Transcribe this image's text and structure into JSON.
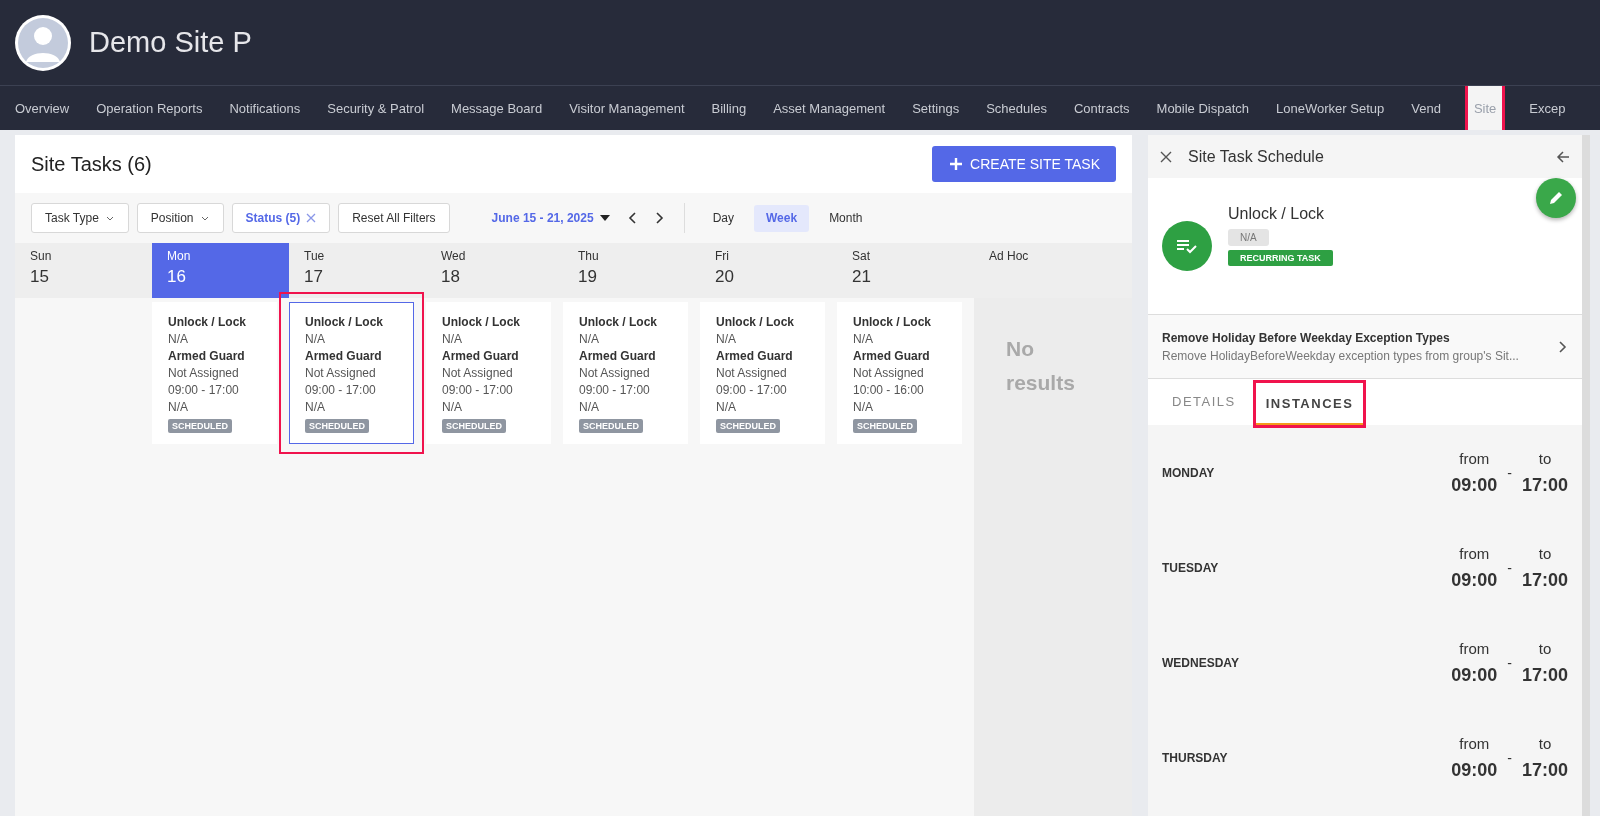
{
  "site": {
    "name": "Demo Site P"
  },
  "nav": [
    {
      "label": "Overview",
      "selected": false,
      "highlighted": false
    },
    {
      "label": "Operation Reports",
      "selected": false,
      "highlighted": false
    },
    {
      "label": "Notifications",
      "selected": false,
      "highlighted": false
    },
    {
      "label": "Security & Patrol",
      "selected": false,
      "highlighted": false
    },
    {
      "label": "Message Board",
      "selected": false,
      "highlighted": false
    },
    {
      "label": "Visitor Management",
      "selected": false,
      "highlighted": false
    },
    {
      "label": "Billing",
      "selected": false,
      "highlighted": false
    },
    {
      "label": "Asset Management",
      "selected": false,
      "highlighted": false
    },
    {
      "label": "Settings",
      "selected": false,
      "highlighted": false
    },
    {
      "label": "Schedules",
      "selected": false,
      "highlighted": false
    },
    {
      "label": "Contracts",
      "selected": false,
      "highlighted": false
    },
    {
      "label": "Mobile Dispatch",
      "selected": false,
      "highlighted": false
    },
    {
      "label": "LoneWorker Setup",
      "selected": false,
      "highlighted": false
    },
    {
      "label": "Vend",
      "selected": false,
      "highlighted": false
    },
    {
      "label": "Site",
      "selected": true,
      "highlighted": true
    },
    {
      "label": "Excep",
      "selected": false,
      "highlighted": false
    }
  ],
  "tasks": {
    "title": "Site Tasks (6)",
    "create_button": "CREATE SITE TASK",
    "filters": [
      {
        "label": "Task Type",
        "kind": "dropdown",
        "active": false
      },
      {
        "label": "Position",
        "kind": "dropdown",
        "active": false
      },
      {
        "label": "Status (5)",
        "kind": "clearable",
        "active": true
      },
      {
        "label": "Reset All Filters",
        "kind": "button",
        "active": false
      }
    ],
    "date_range": "June 15 - 21, 2025",
    "views": [
      {
        "label": "Day",
        "selected": false
      },
      {
        "label": "Week",
        "selected": true
      },
      {
        "label": "Month",
        "selected": false
      }
    ],
    "days": [
      {
        "weekday": "Sun",
        "date": "15",
        "selected": false
      },
      {
        "weekday": "Mon",
        "date": "16",
        "selected": true,
        "events": [
          {
            "title": "Unlock / Lock",
            "line_1": "N/A",
            "position": "Armed Guard",
            "assignee": "Not Assigned",
            "time": "09:00 - 17:00",
            "line_2": "N/A",
            "status": "SCHEDULED",
            "selected": false,
            "highlighted": false
          }
        ]
      },
      {
        "weekday": "Tue",
        "date": "17",
        "selected": false,
        "events": [
          {
            "title": "Unlock / Lock",
            "line_1": "N/A",
            "position": "Armed Guard",
            "assignee": "Not Assigned",
            "time": "09:00 - 17:00",
            "line_2": "N/A",
            "status": "SCHEDULED",
            "selected": true,
            "highlighted": true
          }
        ]
      },
      {
        "weekday": "Wed",
        "date": "18",
        "selected": false,
        "events": [
          {
            "title": "Unlock / Lock",
            "line_1": "N/A",
            "position": "Armed Guard",
            "assignee": "Not Assigned",
            "time": "09:00 - 17:00",
            "line_2": "N/A",
            "status": "SCHEDULED",
            "selected": false,
            "highlighted": false
          }
        ]
      },
      {
        "weekday": "Thu",
        "date": "19",
        "selected": false,
        "events": [
          {
            "title": "Unlock / Lock",
            "line_1": "N/A",
            "position": "Armed Guard",
            "assignee": "Not Assigned",
            "time": "09:00 - 17:00",
            "line_2": "N/A",
            "status": "SCHEDULED",
            "selected": false,
            "highlighted": false
          }
        ]
      },
      {
        "weekday": "Fri",
        "date": "20",
        "selected": false,
        "events": [
          {
            "title": "Unlock / Lock",
            "line_1": "N/A",
            "position": "Armed Guard",
            "assignee": "Not Assigned",
            "time": "09:00 - 17:00",
            "line_2": "N/A",
            "status": "SCHEDULED",
            "selected": false,
            "highlighted": false
          }
        ]
      },
      {
        "weekday": "Sat",
        "date": "21",
        "selected": false,
        "events": [
          {
            "title": "Unlock / Lock",
            "line_1": "N/A",
            "position": "Armed Guard",
            "assignee": "Not Assigned",
            "time": "10:00 - 16:00",
            "line_2": "N/A",
            "status": "SCHEDULED",
            "selected": false,
            "highlighted": false
          }
        ]
      }
    ],
    "ad_hoc": {
      "title": "Ad Hoc",
      "empty_text": "No results"
    }
  },
  "detail": {
    "title": "Site Task Schedule",
    "task_name": "Unlock / Lock",
    "tag": "N/A",
    "badge": "RECURRING TASK",
    "exception": {
      "title": "Remove Holiday Before Weekday Exception Types",
      "subtitle": "Remove HolidayBeforeWeekday exception types from group's Sit..."
    },
    "tabs": [
      {
        "label": "DETAILS",
        "selected": false,
        "highlighted": false
      },
      {
        "label": "INSTANCES",
        "selected": true,
        "highlighted": true
      }
    ],
    "instances": [
      {
        "day": "MONDAY",
        "from_label": "from",
        "from": "09:00",
        "separator": "-",
        "to_label": "to",
        "to": "17:00"
      },
      {
        "day": "TUESDAY",
        "from_label": "from",
        "from": "09:00",
        "separator": "-",
        "to_label": "to",
        "to": "17:00"
      },
      {
        "day": "WEDNESDAY",
        "from_label": "from",
        "from": "09:00",
        "separator": "-",
        "to_label": "to",
        "to": "17:00"
      },
      {
        "day": "THURSDAY",
        "from_label": "from",
        "from": "09:00",
        "separator": "-",
        "to_label": "to",
        "to": "17:00"
      }
    ]
  }
}
